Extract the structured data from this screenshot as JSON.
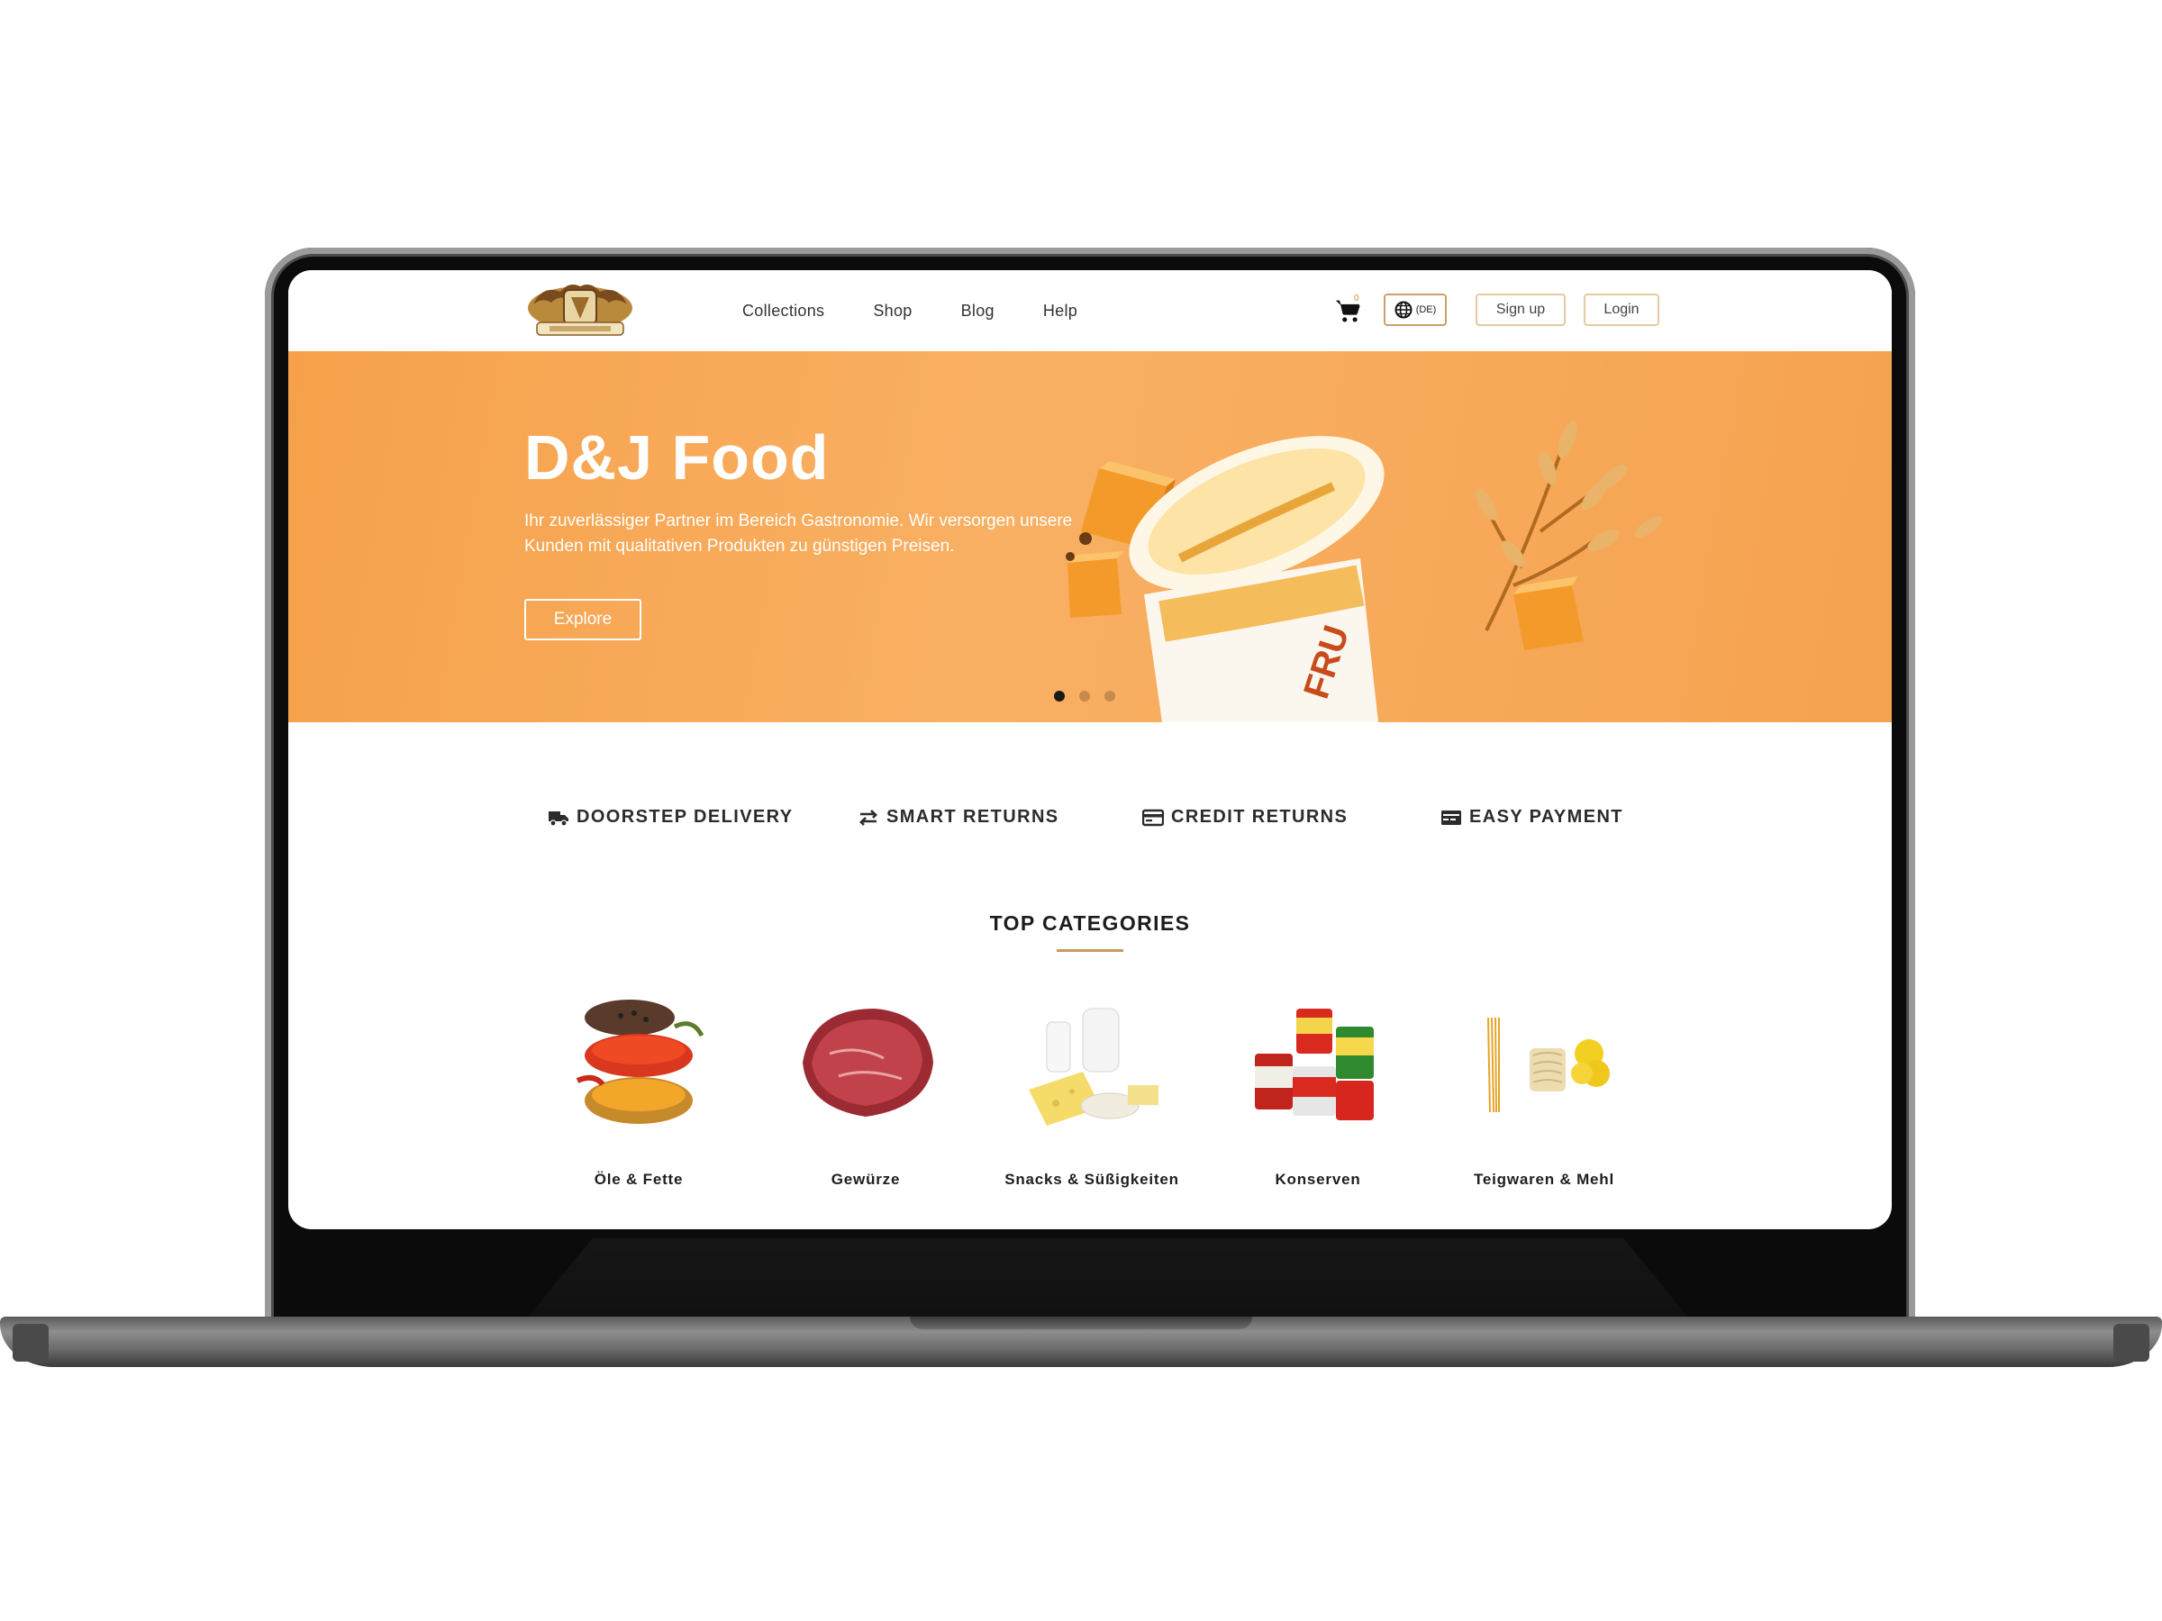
{
  "nav": {
    "links": [
      "Collections",
      "Shop",
      "Blog",
      "Help"
    ],
    "cart_count": "0",
    "language": "(DE)",
    "signup_label": "Sign up",
    "login_label": "Login"
  },
  "hero": {
    "title": "D&J Food",
    "text": "Ihr zuverlässiger Partner im Bereich Gastronomie. Wir versorgen unsere Kunden mit qualitativen Produkten zu günstigen Preisen.",
    "cta_label": "Explore",
    "slides": 3,
    "active_slide": 1
  },
  "features": [
    {
      "label": "DOORSTEP DELIVERY",
      "icon": "truck-icon"
    },
    {
      "label": "SMART RETURNS",
      "icon": "exchange-icon"
    },
    {
      "label": "CREDIT RETURNS",
      "icon": "credit-card-icon"
    },
    {
      "label": "EASY PAYMENT",
      "icon": "wallet-icon"
    }
  ],
  "categories": {
    "heading": "TOP CATEGORIES",
    "items": [
      {
        "label": "Öle & Fette",
        "icon": "spices-image"
      },
      {
        "label": "Gewürze",
        "icon": "meat-image"
      },
      {
        "label": "Snacks & Süßigkeiten",
        "icon": "dairy-image"
      },
      {
        "label": "Konserven",
        "icon": "canned-goods-image"
      },
      {
        "label": "Teigwaren & Mehl",
        "icon": "pasta-image"
      }
    ]
  },
  "colors": {
    "accent": "#c89a5f",
    "hero": "#f7a855",
    "text": "#1e1e1e"
  }
}
